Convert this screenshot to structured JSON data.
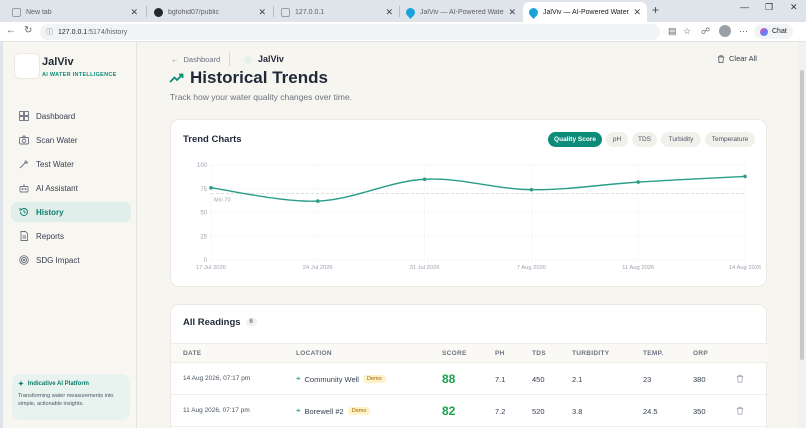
{
  "browser": {
    "tabs": [
      {
        "title": "New tab",
        "active": false
      },
      {
        "title": "bgtohid07/public",
        "active": false
      },
      {
        "title": "127.0.0.1",
        "active": false
      },
      {
        "title": "JalViv — AI-Powered Water Intellig",
        "active": false
      },
      {
        "title": "JalViv — AI-Powered Water Intellig",
        "active": true
      }
    ],
    "url_host": "127.0.0.1",
    "url_path": ":5174/history",
    "chat_label": "Chat"
  },
  "sidebar": {
    "brand": "JalViv",
    "brand_sub": "AI WATER INTELLIGENCE",
    "items": [
      {
        "label": "Dashboard",
        "icon": "grid-icon",
        "active": false
      },
      {
        "label": "Scan Water",
        "icon": "camera-icon",
        "active": false
      },
      {
        "label": "Test Water",
        "icon": "pipette-icon",
        "active": false
      },
      {
        "label": "AI Assistant",
        "icon": "bot-icon",
        "active": false
      },
      {
        "label": "History",
        "icon": "history-icon",
        "active": true
      },
      {
        "label": "Reports",
        "icon": "report-icon",
        "active": false
      },
      {
        "label": "SDG Impact",
        "icon": "target-icon",
        "active": false
      }
    ],
    "promo": {
      "title": "Indicative AI Platform",
      "desc": "Transforming water measurements into simple, actionable insights."
    }
  },
  "header": {
    "back_label": "Dashboard",
    "brand": "JalViv",
    "clear_label": "Clear All",
    "title": "Historical Trends",
    "subtitle": "Track how your water quality changes over time."
  },
  "trend": {
    "title": "Trend Charts",
    "tabs": [
      "Quality Score",
      "pH",
      "TDS",
      "Turbidity",
      "Temperature"
    ],
    "active_tab": "Quality Score"
  },
  "chart_data": {
    "type": "line",
    "x": [
      "17 Jul 2026",
      "24 Jul 2026",
      "31 Jul 2026",
      "7 Aug 2026",
      "11 Aug 2026",
      "14 Aug 2026"
    ],
    "y": [
      76,
      62,
      85,
      74,
      82,
      88
    ],
    "ylim": [
      0,
      100
    ],
    "yticks": [
      0,
      25,
      50,
      75,
      100
    ],
    "reference_line": {
      "value": 70,
      "label": "Min 70"
    },
    "grid": true,
    "color": "#2a9d8a"
  },
  "readings": {
    "title": "All Readings",
    "count": "6",
    "columns": [
      "DATE",
      "LOCATION",
      "SCORE",
      "PH",
      "TDS",
      "TURBIDITY",
      "TEMP.",
      "ORP"
    ],
    "rows": [
      {
        "date": "14 Aug 2026, 07:17 pm",
        "location": "Community Well",
        "badge": "Demo",
        "score": "88",
        "ph": "7.1",
        "tds": "450",
        "turbidity": "2.1",
        "temp": "23",
        "orp": "380"
      },
      {
        "date": "11 Aug 2026, 07:17 pm",
        "location": "Borewell #2",
        "badge": "Demo",
        "score": "82",
        "ph": "7.2",
        "tds": "520",
        "turbidity": "3.8",
        "temp": "24.5",
        "orp": "350"
      }
    ]
  }
}
